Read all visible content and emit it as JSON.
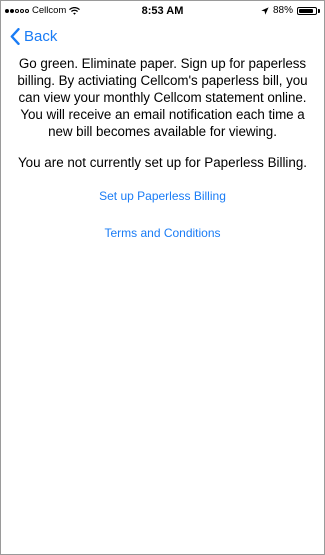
{
  "status_bar": {
    "carrier": "Cellcom",
    "time": "8:53 AM",
    "battery_percent": "88%",
    "battery_level": 0.88,
    "signal_bars_filled": 2,
    "signal_bars_total": 5,
    "icons": [
      "wifi-icon",
      "location-arrow-icon",
      "battery-icon"
    ]
  },
  "nav": {
    "back_label": "Back",
    "accent_color": "#1a7cf5"
  },
  "content": {
    "intro": "Go green. Eliminate paper. Sign up for paperless billing. By activiating Cellcom's paperless bill, you can view your monthly Cellcom statement online. You will receive an email notification each time a new bill becomes available for viewing.",
    "status": "You are not currently set up for Paperless Billing.",
    "setup_link": "Set up Paperless Billing",
    "terms_link": "Terms and Conditions"
  }
}
